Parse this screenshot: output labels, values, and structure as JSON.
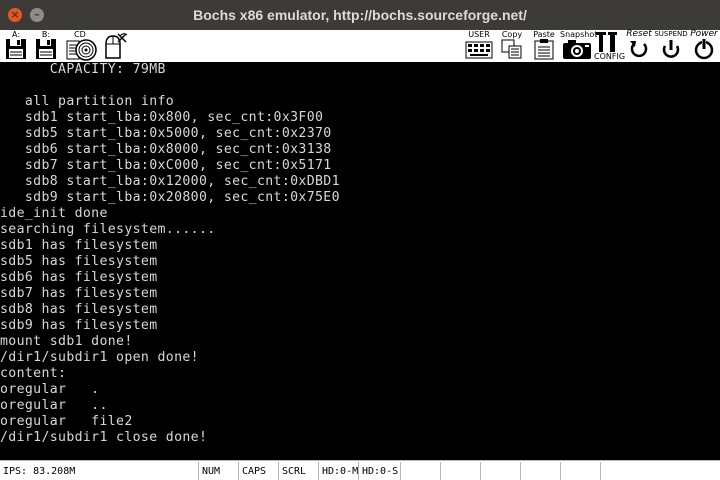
{
  "window": {
    "title": "Bochs x86 emulator, http://bochs.sourceforge.net/",
    "close_glyph": "×",
    "minimize_glyph": "–"
  },
  "toolbar": {
    "floppy_a_label": "A:",
    "floppy_b_label": "B:",
    "cdrom_label": "CD",
    "user_label": "USER",
    "copy_label": "Copy",
    "paste_label": "Paste",
    "snapshot_label": "Snapshot",
    "config_label": "CONFIG",
    "reset_label": "Reset",
    "suspend_label": "SUSPEND",
    "power_label": "Power"
  },
  "console": {
    "lines": [
      "      CAPACITY: 79MB",
      "",
      "   all partition info",
      "   sdb1 start_lba:0x800, sec_cnt:0x3F00",
      "   sdb5 start_lba:0x5000, sec_cnt:0x2370",
      "   sdb6 start_lba:0x8000, sec_cnt:0x3138",
      "   sdb7 start_lba:0xC000, sec_cnt:0x5171",
      "   sdb8 start_lba:0x12000, sec_cnt:0xDBD1",
      "   sdb9 start_lba:0x20800, sec_cnt:0x75E0",
      "ide_init done",
      "searching filesystem......",
      "sdb1 has filesystem",
      "sdb5 has filesystem",
      "sdb6 has filesystem",
      "sdb7 has filesystem",
      "sdb8 has filesystem",
      "sdb9 has filesystem",
      "mount sdb1 done!",
      "/dir1/subdir1 open done!",
      "content:",
      "oregular   .",
      "oregular   ..",
      "oregular   file2",
      "/dir1/subdir1 close done!"
    ]
  },
  "status": {
    "ips": "IPS: 83.208M",
    "num": "NUM",
    "caps": "CAPS",
    "scrl": "SCRL",
    "hd0_master": "HD:0-M",
    "hd0_slave": "HD:0-S"
  },
  "colors": {
    "titlebar": "#3c3b37",
    "close_button": "#e9541f",
    "console_bg": "#000000",
    "console_text": "#d8d8d8",
    "toolbar_bg": "#ffffff"
  }
}
